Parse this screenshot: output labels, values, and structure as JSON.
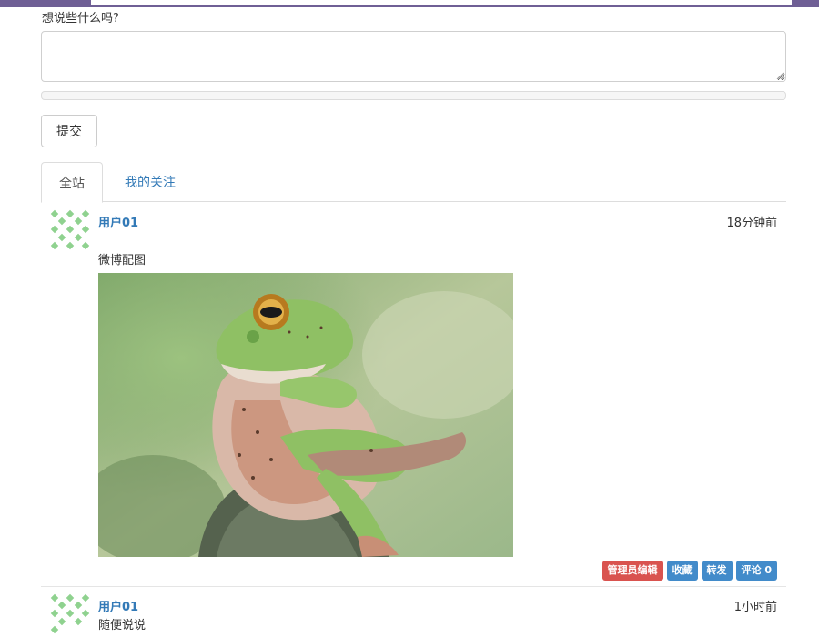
{
  "compose": {
    "label": "想说些什么吗?",
    "textarea_value": "",
    "upload_progress": 0,
    "submit_label": "提交"
  },
  "tabs": [
    {
      "label": "全站",
      "active": true
    },
    {
      "label": "我的关注",
      "active": false
    }
  ],
  "posts": [
    {
      "username": "用户01",
      "time": "18分钟前",
      "text": "微博配图",
      "has_image": true,
      "actions": {
        "admin_edit": "管理员编辑",
        "favorite": "收藏",
        "repost": "转发",
        "comment": "评论 0"
      }
    },
    {
      "username": "用户01",
      "time": "1小时前",
      "text": "随便说说"
    }
  ],
  "colors": {
    "link": "#337ab7",
    "danger": "#d9534f",
    "primary": "#428bca",
    "header": "#6f5f95"
  }
}
